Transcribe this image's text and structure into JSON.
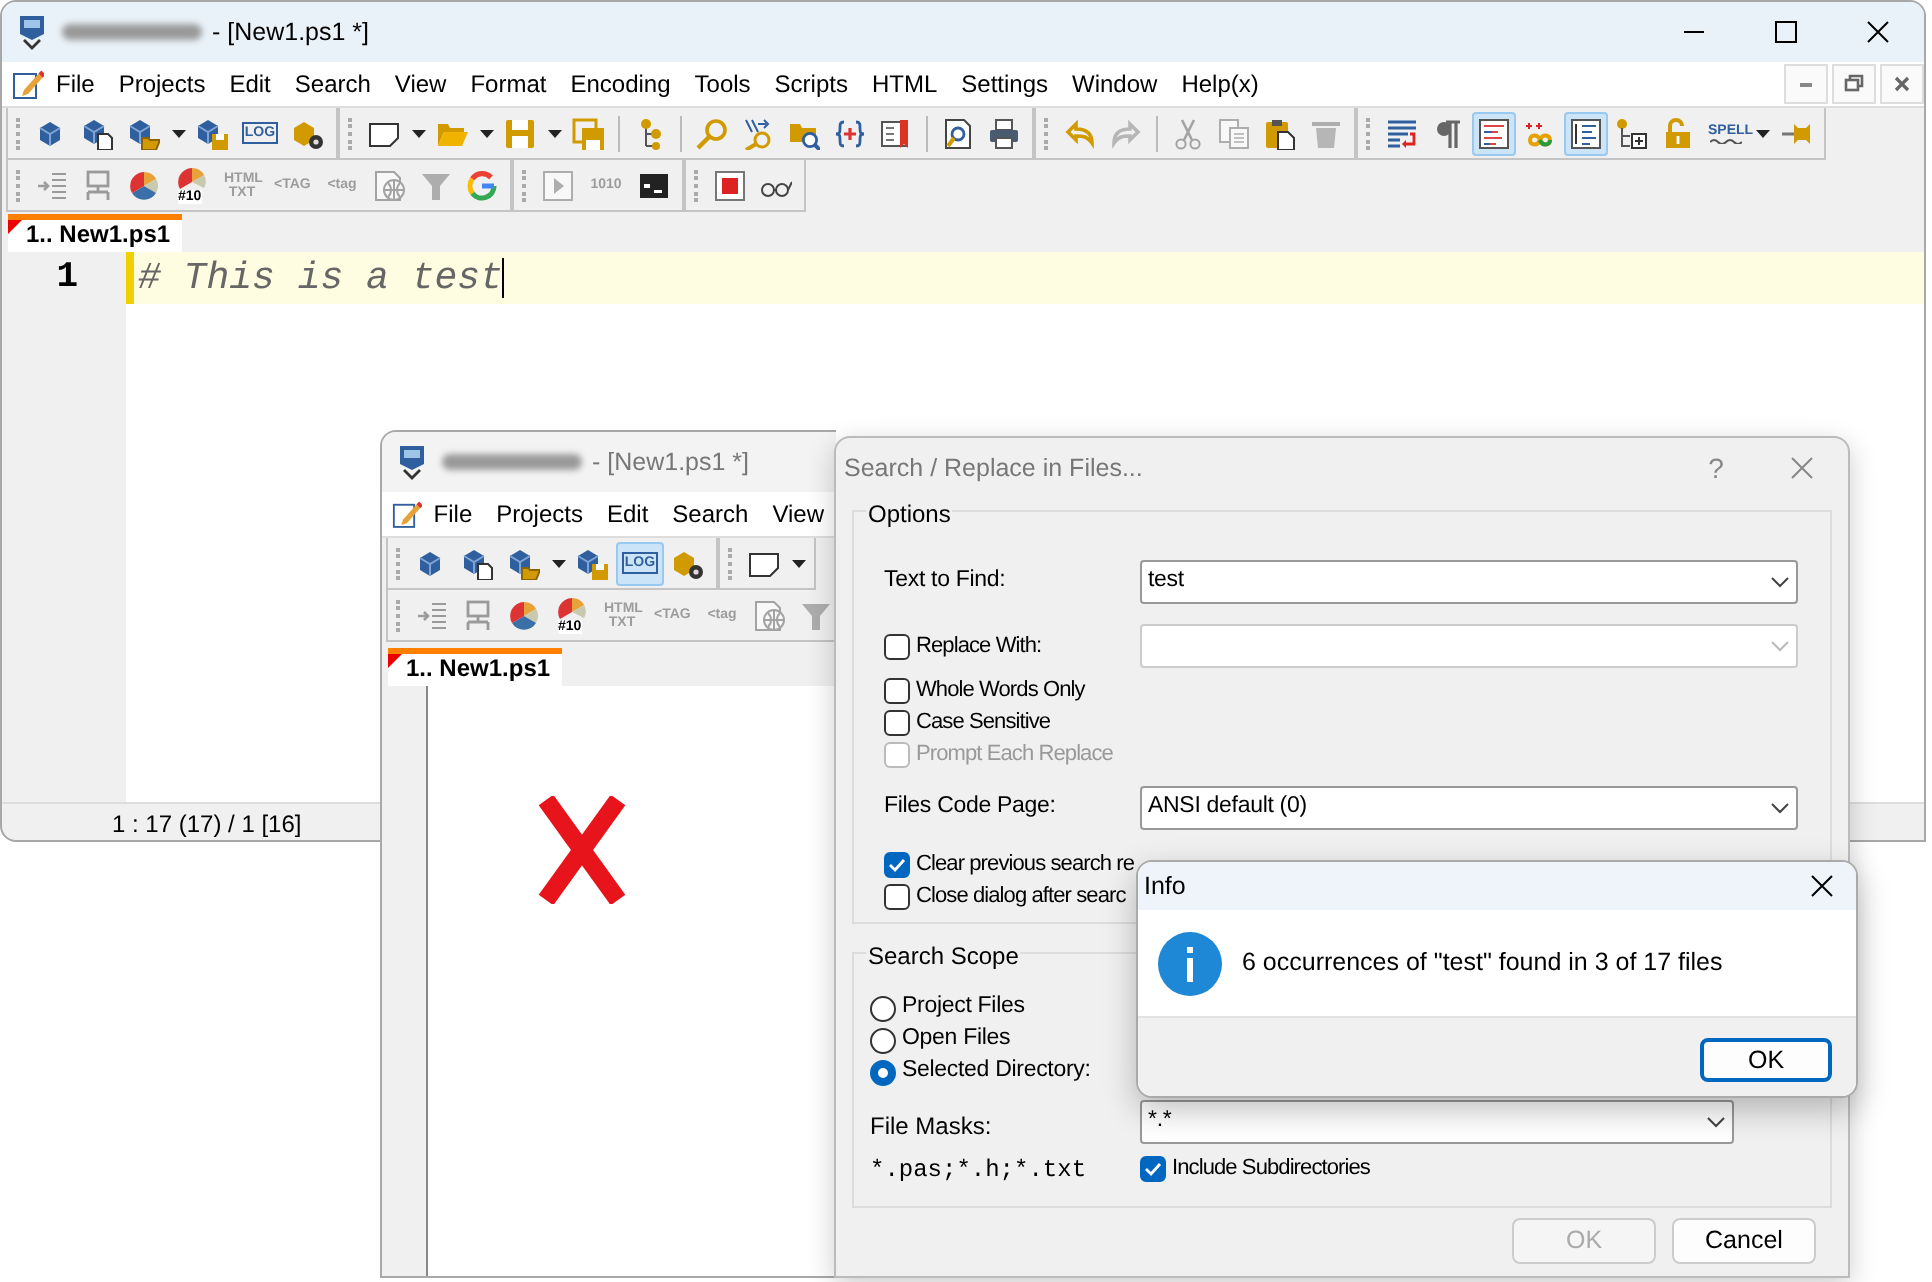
{
  "main_window": {
    "title": "- [New1.ps1 *]",
    "menu": [
      {
        "label": "File"
      },
      {
        "label": "Projects"
      },
      {
        "label": "Edit"
      },
      {
        "label": "Search"
      },
      {
        "label": "View"
      },
      {
        "label": "Format"
      },
      {
        "label": "Encoding"
      },
      {
        "label": "Tools"
      },
      {
        "label": "Scripts"
      },
      {
        "label": "HTML"
      },
      {
        "label": "Settings"
      },
      {
        "label": "Window"
      },
      {
        "label": "Help(x)"
      }
    ],
    "toolbars": [
      [
        [
          {
            "pressed": false,
            "disabled": false
          },
          {
            "pressed": false,
            "disabled": false
          },
          {
            "pressed": false,
            "disabled": false
          },
          {
            "pressed": false,
            "disabled": false
          },
          {
            "pressed": false,
            "disabled": false
          },
          {
            "pressed": false,
            "disabled": false,
            "label": "LOG"
          },
          {
            "pressed": false,
            "disabled": false
          }
        ],
        [
          {
            "pressed": false,
            "disabled": false
          },
          {
            "pressed": false,
            "disabled": false
          },
          {
            "pressed": false,
            "disabled": false
          },
          {
            "pressed": false,
            "disabled": false
          },
          {
            "pressed": false,
            "disabled": false
          },
          {
            "pressed": false,
            "disabled": false
          },
          {
            "pressed": false,
            "disabled": false
          },
          {
            "pressed": false,
            "disabled": false
          },
          {
            "pressed": false,
            "disabled": false
          },
          {
            "pressed": false,
            "disabled": false
          },
          {
            "pressed": false,
            "disabled": false
          },
          {
            "pressed": false,
            "disabled": false
          },
          {
            "pressed": false,
            "disabled": false
          },
          {
            "pressed": false,
            "disabled": false
          },
          {
            "pressed": false,
            "disabled": false
          }
        ],
        [
          {
            "pressed": false,
            "disabled": false
          },
          {
            "pressed": false,
            "disabled": true
          },
          {
            "pressed": false,
            "disabled": true
          },
          {
            "pressed": false,
            "disabled": true
          },
          {
            "pressed": false,
            "disabled": false
          },
          {
            "pressed": false,
            "disabled": true
          }
        ],
        [
          {
            "pressed": false,
            "disabled": false
          },
          {
            "pressed": false,
            "disabled": false
          },
          {
            "pressed": true,
            "disabled": false
          },
          {
            "pressed": false,
            "disabled": false
          },
          {
            "pressed": true,
            "disabled": false
          },
          {
            "pressed": false,
            "disabled": false
          },
          {
            "pressed": false,
            "disabled": false
          },
          {
            "pressed": false,
            "disabled": false,
            "label": "SPELL"
          },
          {
            "pressed": false,
            "disabled": false
          },
          {
            "pressed": false,
            "disabled": false
          }
        ]
      ],
      [
        [
          {
            "pressed": false,
            "disabled": true
          },
          {
            "pressed": false,
            "disabled": true
          },
          {
            "pressed": false,
            "disabled": false
          },
          {
            "pressed": false,
            "disabled": false,
            "label": "#10"
          },
          {
            "pressed": false,
            "disabled": true,
            "label": "HTML TXT"
          },
          {
            "pressed": false,
            "disabled": true,
            "label": "<TAG"
          },
          {
            "pressed": false,
            "disabled": true,
            "label": "<tag"
          },
          {
            "pressed": false,
            "disabled": true
          },
          {
            "pressed": false,
            "disabled": true
          },
          {
            "pressed": false,
            "disabled": false
          }
        ],
        [
          {
            "pressed": false,
            "disabled": true
          },
          {
            "pressed": false,
            "disabled": true,
            "label": "1010"
          },
          {
            "pressed": false,
            "disabled": false
          }
        ],
        [
          {
            "pressed": false,
            "disabled": false
          },
          {
            "pressed": false,
            "disabled": false
          }
        ]
      ]
    ],
    "tabs": [
      {
        "label": "1.. New1.ps1",
        "selected": true
      }
    ],
    "editor": {
      "lines": [
        {
          "number": "1",
          "text": "# This is a test",
          "current": true
        }
      ]
    },
    "status_bar": "1 : 17 (17) / 1  [16]"
  },
  "background_window": {
    "title": "- [New1.ps1 *]",
    "menu": [
      {
        "label": "File"
      },
      {
        "label": "Projects"
      },
      {
        "label": "Edit"
      },
      {
        "label": "Search"
      },
      {
        "label": "View"
      }
    ],
    "toolbars": [
      [
        [
          {
            "pressed": false,
            "disabled": false
          },
          {
            "pressed": false,
            "disabled": false
          },
          {
            "pressed": false,
            "disabled": false
          },
          {
            "pressed": false,
            "disabled": false
          },
          {
            "pressed": false,
            "disabled": false
          },
          {
            "pressed": true,
            "disabled": false,
            "label": "LOG"
          },
          {
            "pressed": false,
            "disabled": false
          }
        ],
        [
          {
            "pressed": false,
            "disabled": false
          },
          {
            "pressed": false,
            "disabled": false
          }
        ]
      ],
      [
        [
          {
            "pressed": false,
            "disabled": true
          },
          {
            "pressed": false,
            "disabled": true
          },
          {
            "pressed": false,
            "disabled": false
          },
          {
            "pressed": false,
            "disabled": false,
            "label": "#10"
          },
          {
            "pressed": false,
            "disabled": true,
            "label": "HTML TXT"
          },
          {
            "pressed": false,
            "disabled": true,
            "label": "<TAG"
          },
          {
            "pressed": false,
            "disabled": true,
            "label": "<tag"
          },
          {
            "pressed": false,
            "disabled": true
          },
          {
            "pressed": false,
            "disabled": true
          }
        ]
      ]
    ],
    "tabs": [
      {
        "label": "1.. New1.ps1",
        "selected": true
      }
    ]
  },
  "search_dialog": {
    "title": "Search / Replace in Files...",
    "help": "?",
    "options": {
      "legend": "Options",
      "text_to_find": {
        "label": "Text to Find:",
        "value": "test"
      },
      "replace_with": {
        "label": "Replace With:",
        "checked": false
      },
      "checkboxes": [
        {
          "label": "Whole Words Only",
          "checked": false,
          "disabled": false
        },
        {
          "label": "Case Sensitive",
          "checked": false,
          "disabled": false
        },
        {
          "label": "Prompt Each Replace",
          "checked": false,
          "disabled": true
        }
      ],
      "files_code_page": {
        "label": "Files Code Page:",
        "value": "ANSI default (0)"
      },
      "checkboxes_2": [
        {
          "label": "Clear previous search re",
          "checked": true
        },
        {
          "label": "Close dialog after searc",
          "checked": false
        }
      ]
    },
    "search_scope": {
      "legend": "Search Scope",
      "radios": [
        {
          "label": "Project Files",
          "selected": false
        },
        {
          "label": "Open Files",
          "selected": false
        },
        {
          "label": "Selected Directory:",
          "selected": true
        }
      ],
      "file_masks": {
        "label": "File Masks:",
        "hint": "*.pas;*.h;*.txt",
        "value": "*.*"
      },
      "include_subdirectories": {
        "label": "Include Subdirectories",
        "checked": true
      }
    },
    "buttons": [
      {
        "label": "OK",
        "disabled": true
      },
      {
        "label": "Cancel",
        "disabled": false
      }
    ]
  },
  "info_dialog": {
    "title": "Info",
    "message": "6 occurrences of \"test\" found in 3 of 17 files",
    "button": {
      "label": "OK",
      "default": true
    }
  }
}
